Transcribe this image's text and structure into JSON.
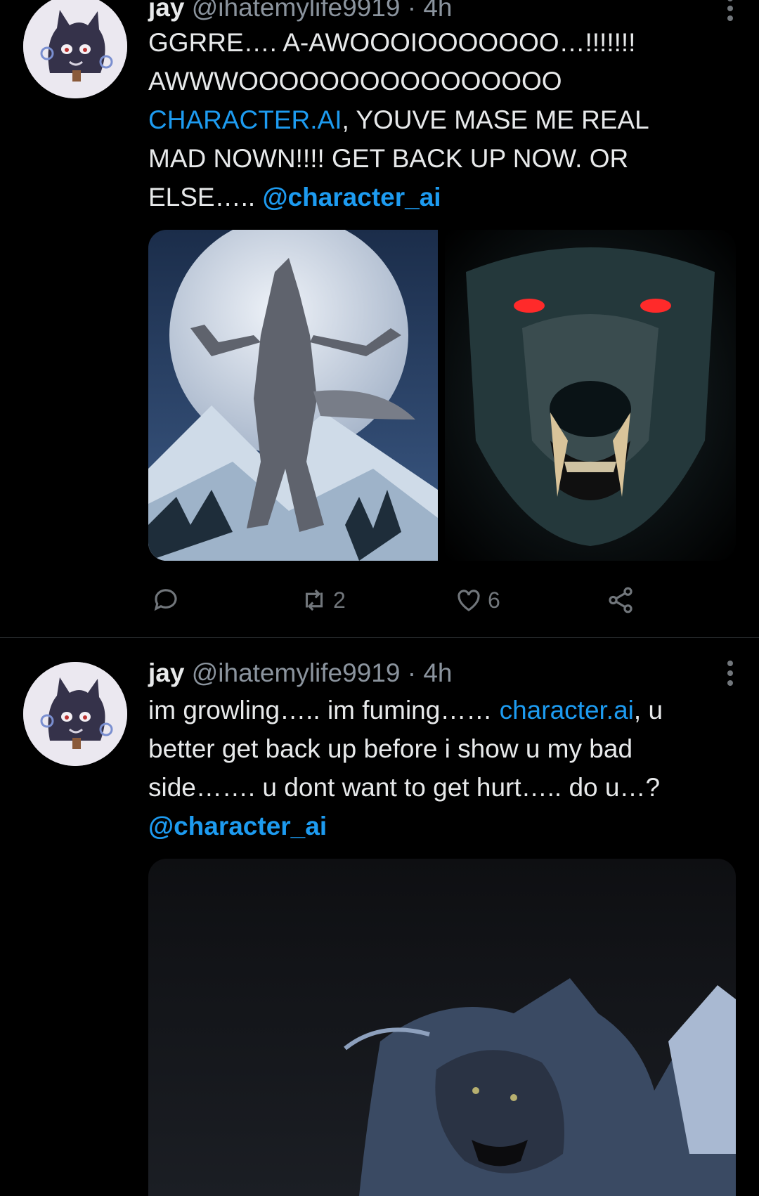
{
  "tweets": [
    {
      "name": "jay",
      "handle": "@ihatemylife9919",
      "time": "· 4h",
      "text_lines": [
        {
          "parts": [
            {
              "t": "GGRRE…. A-AWOOOIOOOOOOO…!!!!!!!"
            }
          ]
        },
        {
          "parts": [
            {
              "t": "AWWWOOOOOOOOOOOOOOOO"
            }
          ]
        },
        {
          "parts": [
            {
              "t": "CHARACTER.AI",
              "link": true
            },
            {
              "t": ", YOUVE MASE ME REAL"
            }
          ]
        },
        {
          "parts": [
            {
              "t": "MAD NOWN!!!! GET BACK UP NOW. OR"
            }
          ]
        },
        {
          "parts": [
            {
              "t": "ELSE….. "
            },
            {
              "t": "@character_ai",
              "mention": true
            }
          ]
        }
      ],
      "media": [
        "werewolf-howling-at-moon-image",
        "red-eyed-wolf-face-image"
      ],
      "actions": {
        "reply": "",
        "retweet": "2",
        "like": "6"
      }
    },
    {
      "name": "jay",
      "handle": "@ihatemylife9919",
      "time": "· 4h",
      "text_lines": [
        {
          "parts": [
            {
              "t": "im growling….. im fuming…… "
            },
            {
              "t": "character.ai",
              "link": true
            },
            {
              "t": ", u"
            }
          ]
        },
        {
          "parts": [
            {
              "t": "better get back up before i show u my bad"
            }
          ]
        },
        {
          "parts": [
            {
              "t": "side……. u dont want to get hurt….. do u…?"
            }
          ]
        },
        {
          "parts": [
            {
              "t": "@character_ai",
              "mention": true
            }
          ]
        }
      ],
      "media": [
        "growling-wolf-image"
      ]
    }
  ],
  "colors": {
    "background": "#000000",
    "link": "#1d9bf0",
    "muted": "#71767b",
    "text": "#e7e9ea"
  }
}
